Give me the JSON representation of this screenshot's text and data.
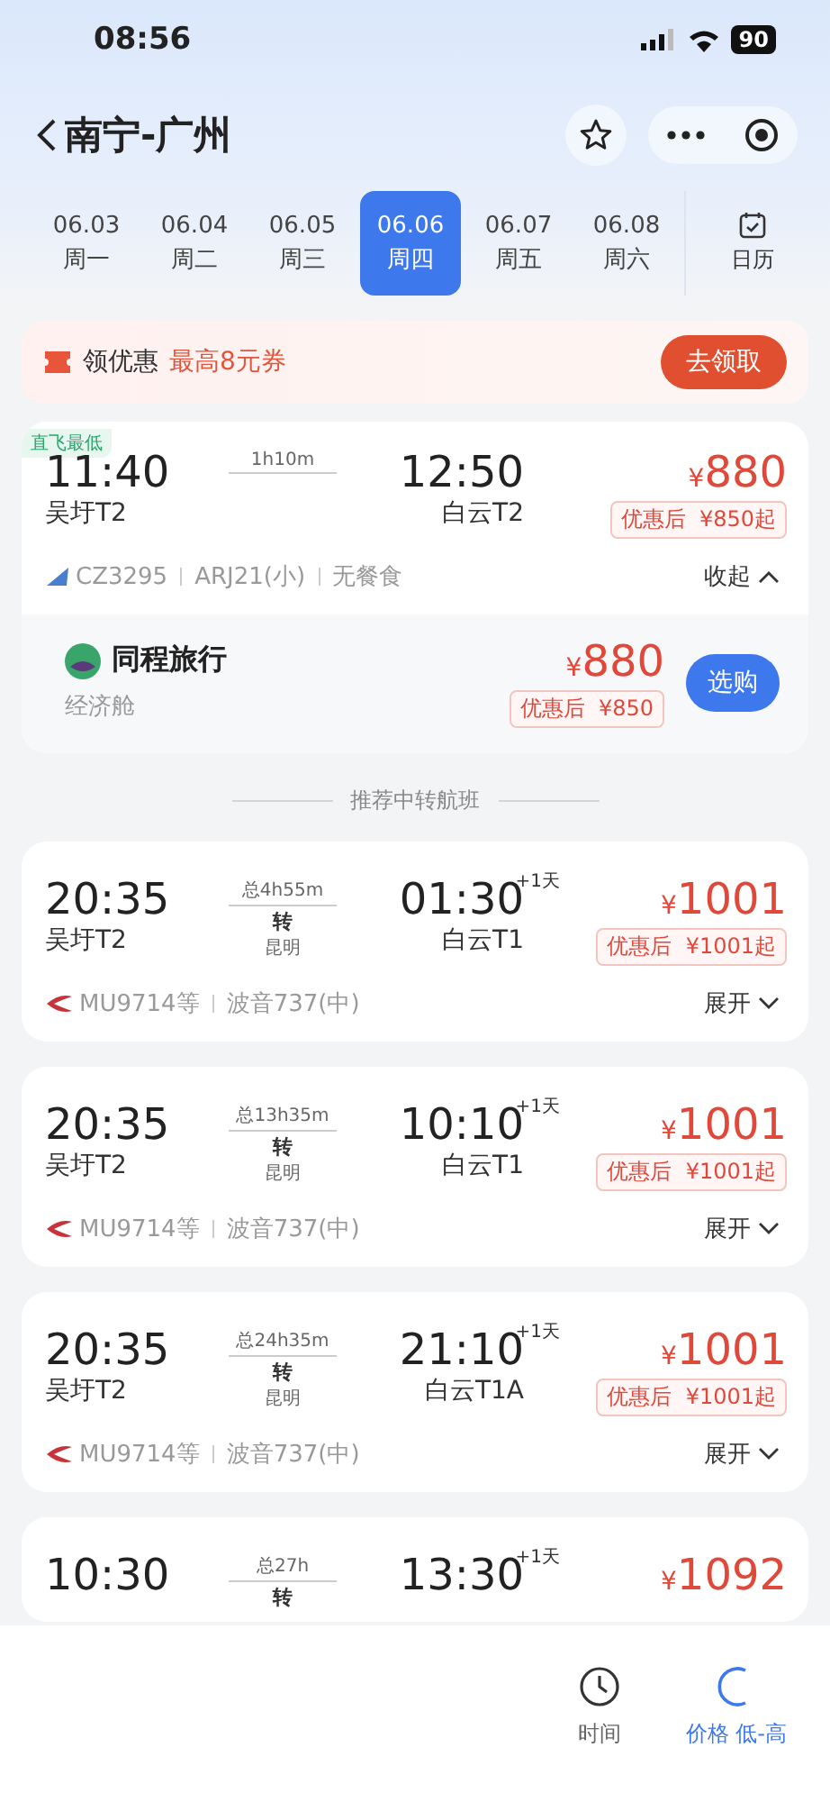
{
  "status_bar": {
    "time": "08:56",
    "battery": "90"
  },
  "header": {
    "title": "南宁-广州"
  },
  "dates": [
    {
      "date": "06.03",
      "weekday": "周一",
      "selected": false
    },
    {
      "date": "06.04",
      "weekday": "周二",
      "selected": false
    },
    {
      "date": "06.05",
      "weekday": "周三",
      "selected": false
    },
    {
      "date": "06.06",
      "weekday": "周四",
      "selected": true
    },
    {
      "date": "06.07",
      "weekday": "周五",
      "selected": false
    },
    {
      "date": "06.08",
      "weekday": "周六",
      "selected": false
    }
  ],
  "calendar_label": "日历",
  "promo": {
    "label": "领优惠",
    "detail": "最高8元券",
    "button": "去领取"
  },
  "direct_flight": {
    "tag": "直飞最低",
    "depart_time": "11:40",
    "depart_airport": "吴圩T2",
    "duration": "1h10m",
    "arrive_time": "12:50",
    "arrive_airport": "白云T2",
    "currency": "¥",
    "price": "880",
    "discount_label": "优惠后",
    "discount_price": "¥850起",
    "flight_no": "CZ3295",
    "aircraft": "ARJ21(小)",
    "meal": "无餐食",
    "toggle": "收起",
    "expanded": true,
    "offer": {
      "vendor": "同程旅行",
      "cabin": "经济舱",
      "currency": "¥",
      "price": "880",
      "discount_label": "优惠后",
      "discount_price": "¥850",
      "button": "选购"
    }
  },
  "section_title": "推荐中转航班",
  "transfers": [
    {
      "depart_time": "20:35",
      "depart_airport": "吴圩T2",
      "total": "总4h55m",
      "transfer": "转",
      "via": "昆明",
      "arrive_time": "01:30",
      "next_day": "+1天",
      "arrive_airport": "白云T1",
      "currency": "¥",
      "price": "1001",
      "discount_label": "优惠后",
      "discount_price": "¥1001起",
      "flight_no": "MU9714等",
      "aircraft": "波音737(中)",
      "toggle": "展开",
      "expanded": false
    },
    {
      "depart_time": "20:35",
      "depart_airport": "吴圩T2",
      "total": "总13h35m",
      "transfer": "转",
      "via": "昆明",
      "arrive_time": "10:10",
      "next_day": "+1天",
      "arrive_airport": "白云T1",
      "currency": "¥",
      "price": "1001",
      "discount_label": "优惠后",
      "discount_price": "¥1001起",
      "flight_no": "MU9714等",
      "aircraft": "波音737(中)",
      "toggle": "展开",
      "expanded": false
    },
    {
      "depart_time": "20:35",
      "depart_airport": "吴圩T2",
      "total": "总24h35m",
      "transfer": "转",
      "via": "昆明",
      "arrive_time": "21:10",
      "next_day": "+1天",
      "arrive_airport": "白云T1A",
      "currency": "¥",
      "price": "1001",
      "discount_label": "优惠后",
      "discount_price": "¥1001起",
      "flight_no": "MU9714等",
      "aircraft": "波音737(中)",
      "toggle": "展开",
      "expanded": false
    },
    {
      "depart_time": "10:30",
      "total": "总27h",
      "transfer": "转",
      "arrive_time": "13:30",
      "next_day": "+1天",
      "currency": "¥",
      "price": "1092"
    }
  ],
  "bottom_bar": [
    {
      "kind": "time",
      "label": "时间",
      "selected": false
    },
    {
      "kind": "price",
      "label": "价格 低-高",
      "selected": true
    }
  ]
}
